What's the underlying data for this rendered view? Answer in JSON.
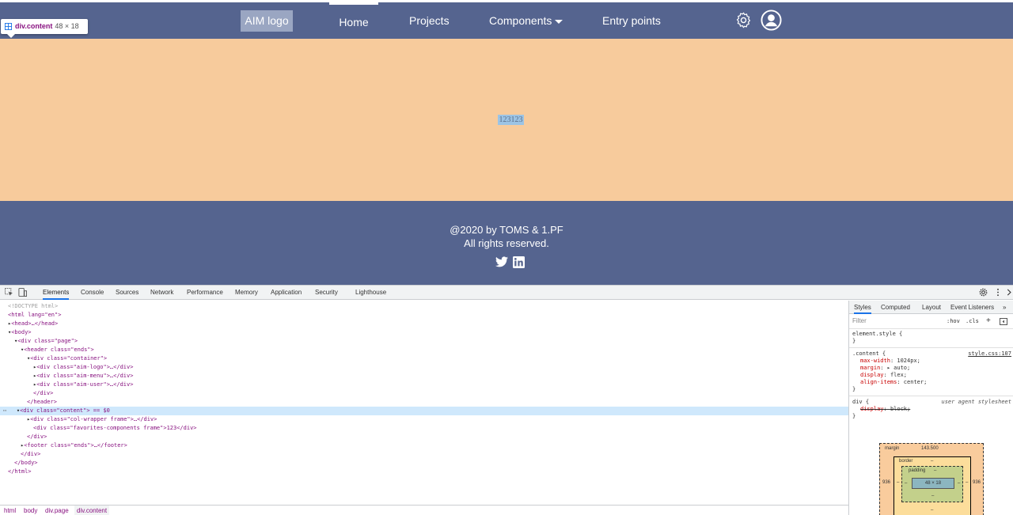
{
  "header": {
    "logo": "AIM logo",
    "nav": [
      "Home",
      "Projects",
      "Components",
      "Entry points"
    ]
  },
  "inspect_tooltip": {
    "tag": "div.content",
    "size": "48 × 18"
  },
  "content": {
    "text": "123123"
  },
  "footer": {
    "copyright": "@2020 by TOMS & 1.PF",
    "rights": "All rights reserved."
  },
  "devtools": {
    "tabs": [
      "Elements",
      "Console",
      "Sources",
      "Network",
      "Performance",
      "Memory",
      "Application",
      "Security",
      "Lighthouse"
    ],
    "dom": [
      "<!DOCTYPE html>",
      "<html lang=\"en\">",
      "<head>…</head>",
      "<body>",
      "<div class=\"page\">",
      "<header class=\"ends\">",
      "<div class=\"container\">",
      "<div class=\"aim-logo\">…</div>",
      "<div class=\"aim-menu\">…</div>",
      "<div class=\"aim-user\">…</div>",
      "</div>",
      "</header>",
      "<div class=\"content\"> == $0",
      "<div class=\"col-wrapper frame\">…</div>",
      "<div class=\"favorites-components frame\">123</div>",
      "</div>",
      "<footer class=\"ends\">…</footer>",
      "</div>",
      "</body>",
      "</html>"
    ],
    "breadcrumbs": [
      "html",
      "body",
      "div.page",
      "div.content"
    ],
    "styles_tabs": [
      "Styles",
      "Computed",
      "Layout",
      "Event Listeners"
    ],
    "filter_placeholder": "Filter",
    "filter_buttons": [
      ":hov",
      ".cls",
      "+"
    ],
    "element_style": "element.style {",
    "content_rule": {
      "selector": ".content {",
      "source": "style.css:107",
      "props": [
        [
          "max-width",
          "1024px;"
        ],
        [
          "margin",
          "▸ auto;"
        ],
        [
          "display",
          "flex;"
        ],
        [
          "align-items",
          "center;"
        ]
      ]
    },
    "ua_rule": {
      "selector": "div {",
      "source": "user agent stylesheet",
      "prop": [
        "display",
        "block;"
      ]
    },
    "box_model": {
      "margin_label": "margin",
      "margin_top": "143.500",
      "margin_side": "936",
      "border_label": "border",
      "padding_label": "padding",
      "dash": "–",
      "content_size": "48 × 18"
    }
  }
}
